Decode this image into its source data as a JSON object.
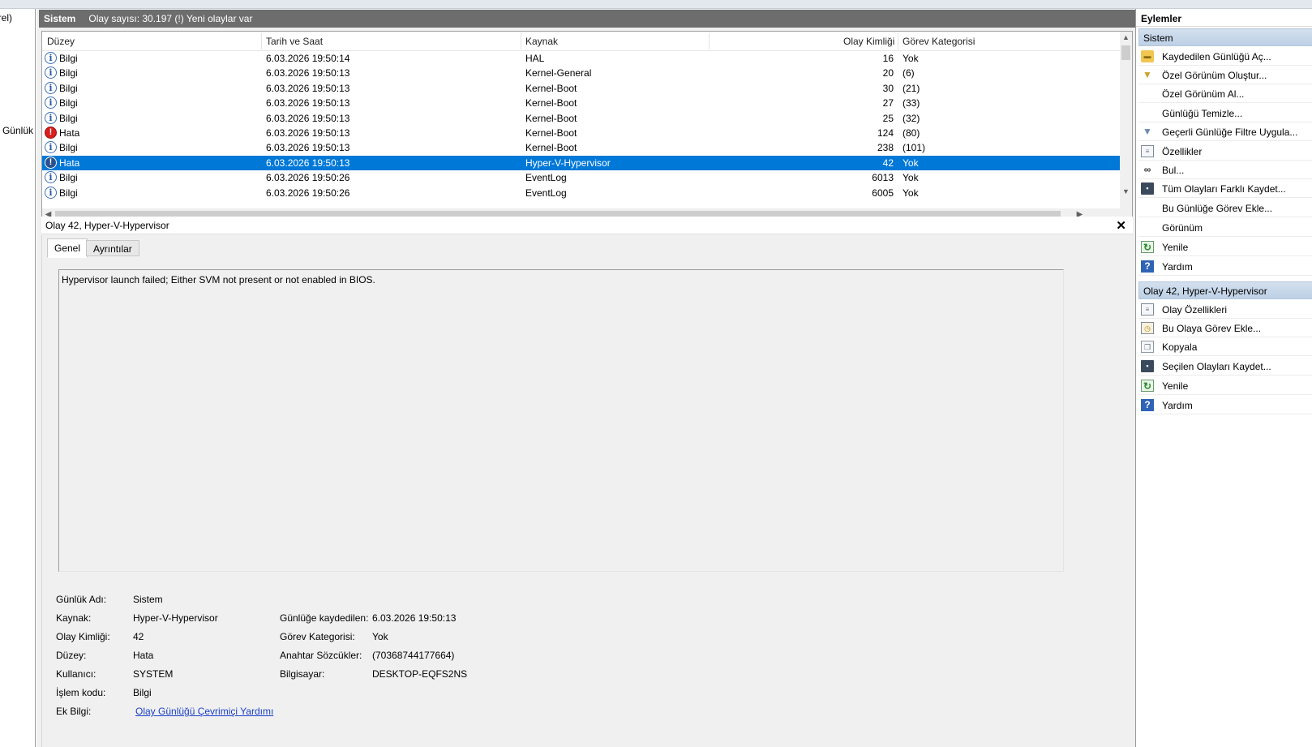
{
  "left_pane": {
    "item_a": "rel)",
    "item_b": "t Günlük"
  },
  "log_header": {
    "title": "Sistem",
    "count_text": "Olay sayısı: 30.197 (!) Yeni olaylar var"
  },
  "grid": {
    "columns": {
      "level": "Düzey",
      "date": "Tarih ve Saat",
      "source": "Kaynak",
      "event_id": "Olay Kimliği",
      "category": "Görev Kategorisi"
    },
    "rows": [
      {
        "icon": "info-icon",
        "level": "Bilgi",
        "date": "6.03.2026 19:50:14",
        "source": "HAL",
        "event_id": "16",
        "category": "Yok"
      },
      {
        "icon": "info-icon",
        "level": "Bilgi",
        "date": "6.03.2026 19:50:13",
        "source": "Kernel-General",
        "event_id": "20",
        "category": "(6)"
      },
      {
        "icon": "info-icon",
        "level": "Bilgi",
        "date": "6.03.2026 19:50:13",
        "source": "Kernel-Boot",
        "event_id": "30",
        "category": "(21)"
      },
      {
        "icon": "info-icon",
        "level": "Bilgi",
        "date": "6.03.2026 19:50:13",
        "source": "Kernel-Boot",
        "event_id": "27",
        "category": "(33)"
      },
      {
        "icon": "info-icon",
        "level": "Bilgi",
        "date": "6.03.2026 19:50:13",
        "source": "Kernel-Boot",
        "event_id": "25",
        "category": "(32)"
      },
      {
        "icon": "error-icon",
        "level": "Hata",
        "date": "6.03.2026 19:50:13",
        "source": "Kernel-Boot",
        "event_id": "124",
        "category": "(80)"
      },
      {
        "icon": "info-icon",
        "level": "Bilgi",
        "date": "6.03.2026 19:50:13",
        "source": "Kernel-Boot",
        "event_id": "238",
        "category": "(101)"
      },
      {
        "icon": "error-icon",
        "level": "Hata",
        "date": "6.03.2026 19:50:13",
        "source": "Hyper-V-Hypervisor",
        "event_id": "42",
        "category": "Yok",
        "selected": true
      },
      {
        "icon": "info-icon",
        "level": "Bilgi",
        "date": "6.03.2026 19:50:26",
        "source": "EventLog",
        "event_id": "6013",
        "category": "Yok"
      },
      {
        "icon": "info-icon",
        "level": "Bilgi",
        "date": "6.03.2026 19:50:26",
        "source": "EventLog",
        "event_id": "6005",
        "category": "Yok"
      }
    ]
  },
  "detail": {
    "title": "Olay 42, Hyper-V-Hypervisor",
    "close_glyph": "✕",
    "tabs": {
      "general": "Genel",
      "details": "Ayrıntılar"
    },
    "description": "Hypervisor launch failed; Either SVM not present or not enabled in BIOS.",
    "props": {
      "log_name_label": "Günlük Adı:",
      "log_name": "Sistem",
      "source_label": "Kaynak:",
      "source": "Hyper-V-Hypervisor",
      "event_id_label": "Olay Kimliği:",
      "event_id": "42",
      "level_label": "Düzey:",
      "level": "Hata",
      "user_label": "Kullanıcı:",
      "user": "SYSTEM",
      "opcode_label": "İşlem kodu:",
      "opcode": "Bilgi",
      "more_info_label": "Ek Bilgi:",
      "more_info_link": "Olay Günlüğü Çevrimiçi Yardımı",
      "logged_label": "Günlüğe kaydedilen:",
      "logged": "6.03.2026 19:50:13",
      "category_label": "Görev Kategorisi:",
      "category": "Yok",
      "keywords_label": "Anahtar Sözcükler:",
      "keywords": "(70368744177664)",
      "computer_label": "Bilgisayar:",
      "computer": "DESKTOP-EQFS2NS"
    }
  },
  "actions": {
    "title": "Eylemler",
    "section_log": "Sistem",
    "log_items": [
      {
        "icon": "folder-open-icon",
        "label": "Kaydedilen Günlüğü Aç..."
      },
      {
        "icon": "filter-icon",
        "label": "Özel Görünüm Oluştur..."
      },
      {
        "icon": "none",
        "label": "Özel Görünüm Al..."
      },
      {
        "icon": "none",
        "label": "Günlüğü Temizle..."
      },
      {
        "icon": "filter-icon",
        "label": "Geçerli Günlüğe Filtre Uygula..."
      },
      {
        "icon": "properties-icon",
        "label": "Özellikler"
      },
      {
        "icon": "binoculars-icon",
        "label": "Bul..."
      },
      {
        "icon": "save-icon",
        "label": "Tüm Olayları Farklı Kaydet..."
      },
      {
        "icon": "none",
        "label": "Bu Günlüğe Görev Ekle..."
      },
      {
        "icon": "none",
        "label": "Görünüm"
      },
      {
        "icon": "refresh-icon",
        "label": "Yenile"
      },
      {
        "icon": "help-icon",
        "label": "Yardım"
      }
    ],
    "section_event": "Olay 42, Hyper-V-Hypervisor",
    "event_items": [
      {
        "icon": "properties-icon",
        "label": "Olay Özellikleri"
      },
      {
        "icon": "task-icon",
        "label": "Bu Olaya Görev Ekle..."
      },
      {
        "icon": "copy-icon",
        "label": "Kopyala"
      },
      {
        "icon": "save-icon",
        "label": "Seçilen Olayları Kaydet..."
      },
      {
        "icon": "refresh-icon",
        "label": "Yenile"
      },
      {
        "icon": "help-icon",
        "label": "Yardım"
      }
    ]
  }
}
